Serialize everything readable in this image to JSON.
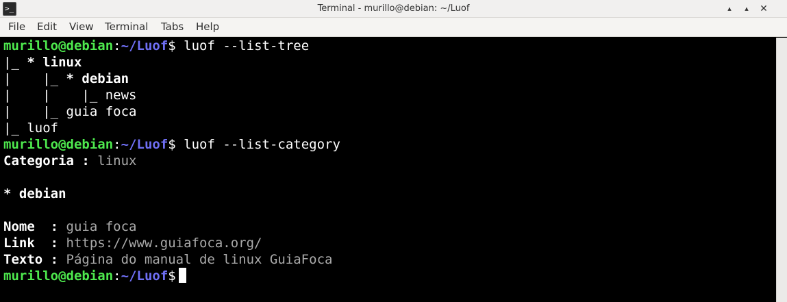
{
  "window": {
    "title": "Terminal - murillo@debian: ~/Luof",
    "icon_glyph": ">_",
    "minimize_glyph": "▴",
    "maximize_glyph": "▴",
    "close_glyph": "✕"
  },
  "menu": {
    "file": "File",
    "edit": "Edit",
    "view": "View",
    "terminal": "Terminal",
    "tabs": "Tabs",
    "help": "Help"
  },
  "prompt": {
    "user": "murillo",
    "at": "@",
    "host": "debian",
    "colon": ":",
    "path": "~/Luof",
    "dollar": "$"
  },
  "session": {
    "cmd1": " luof --list-tree",
    "tree1_prefix": "|_ ",
    "tree1_label": "* linux",
    "tree2_prefix": "|    |_ ",
    "tree2_label": "* debian",
    "tree3": "|    |    |_ news",
    "tree4": "|    |_ guia foca",
    "tree5": "|_ luof",
    "cmd2": " luof --list-category",
    "cat_key": "Categoria : ",
    "cat_val": "linux",
    "blank1": " ",
    "sub_cat": "* debian",
    "blank2": " ",
    "nome_key": "Nome  : ",
    "nome_val": "guia foca",
    "link_key": "Link  : ",
    "link_val": "https://www.guiafoca.org/",
    "texto_key": "Texto : ",
    "texto_val": "Página do manual de linux GuiaFoca"
  }
}
